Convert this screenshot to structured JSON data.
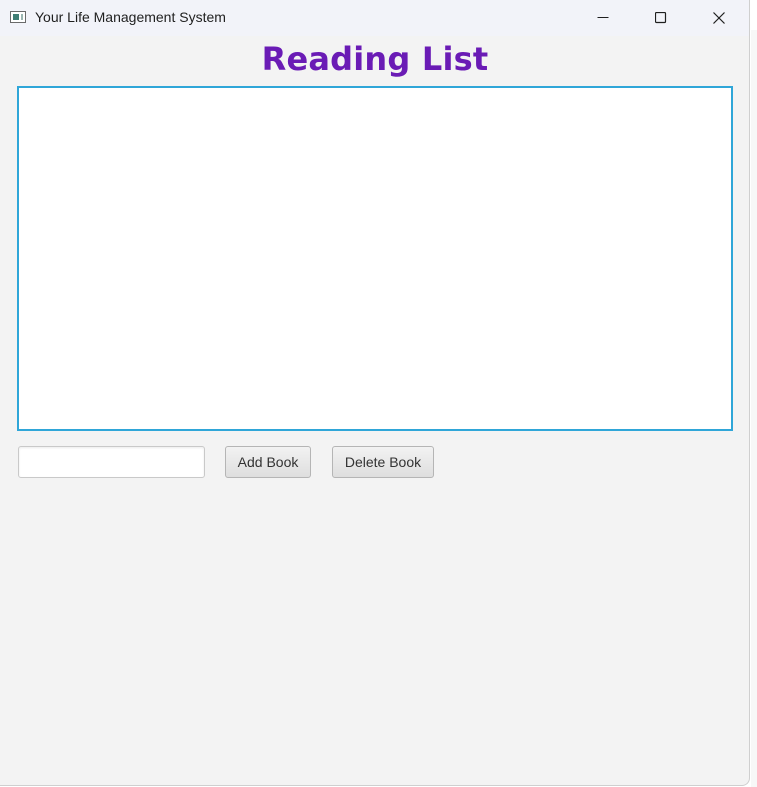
{
  "window": {
    "title": "Your Life Management System",
    "controls": {
      "minimize_icon": "minimize-icon",
      "maximize_icon": "maximize-icon",
      "close_icon": "close-icon"
    }
  },
  "main": {
    "heading": "Reading List",
    "list": {
      "items": []
    },
    "book_input": {
      "value": "",
      "placeholder": ""
    },
    "add_button_label": "Add Book",
    "delete_button_label": "Delete Book"
  },
  "colors": {
    "heading": "#6a1bb5",
    "list_focus_border": "#2fa6d8",
    "window_background": "#f3f3f3"
  }
}
